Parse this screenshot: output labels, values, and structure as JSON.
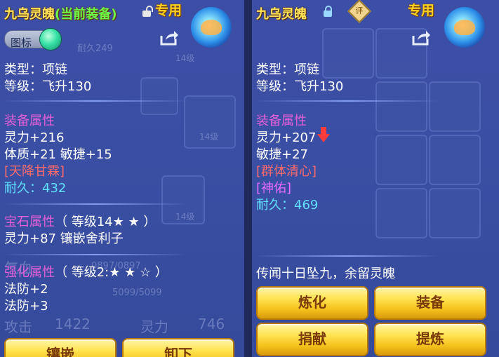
{
  "left": {
    "title": "九乌灵魄",
    "title_suffix": "(当前装备)",
    "exclusive": "专用",
    "icon_toggle_label": "图标",
    "type_line": "类型：项链",
    "level_line": "等级：飞升130",
    "equip_attr_header": "装备属性",
    "attrs": [
      "灵力+216",
      "体质+21 敏捷+15"
    ],
    "special_skill": "[天降甘霖]",
    "durability_label": "耐久：",
    "durability_value": "432",
    "gem_header": "宝石属性",
    "gem_detail": "（ 等级14★ ★ ）",
    "gem_attr": "灵力+87 镶嵌舍利子",
    "enhance_header": "强化属性",
    "enhance_detail": "（ 等级2:★ ★ ☆ ）",
    "enhance_attrs": [
      "法防+2",
      "法防+3"
    ],
    "buttons": [
      "镶嵌",
      "卸下"
    ],
    "bg_texts": [
      "耐久249",
      "1422",
      "灵力",
      "746",
      "攻击",
      "气血",
      "0897/0897",
      "5099/5099",
      "14级",
      "14级",
      "14级"
    ]
  },
  "right": {
    "title": "九乌灵魄",
    "ping_badge": "评",
    "exclusive": "专用",
    "type_line": "类型：项链",
    "level_line": "等级：飞升130",
    "equip_attr_header": "装备属性",
    "attr_line1": "灵力+207",
    "attr_line2": "敏捷+27",
    "special_skill": "[群体清心]",
    "special_effect": "[神佑]",
    "durability_label": "耐久：",
    "durability_value": "469",
    "flavor_text": "传闻十日坠九，余留灵魄",
    "buttons": [
      "炼化",
      "装备",
      "捐献",
      "提炼"
    ]
  }
}
